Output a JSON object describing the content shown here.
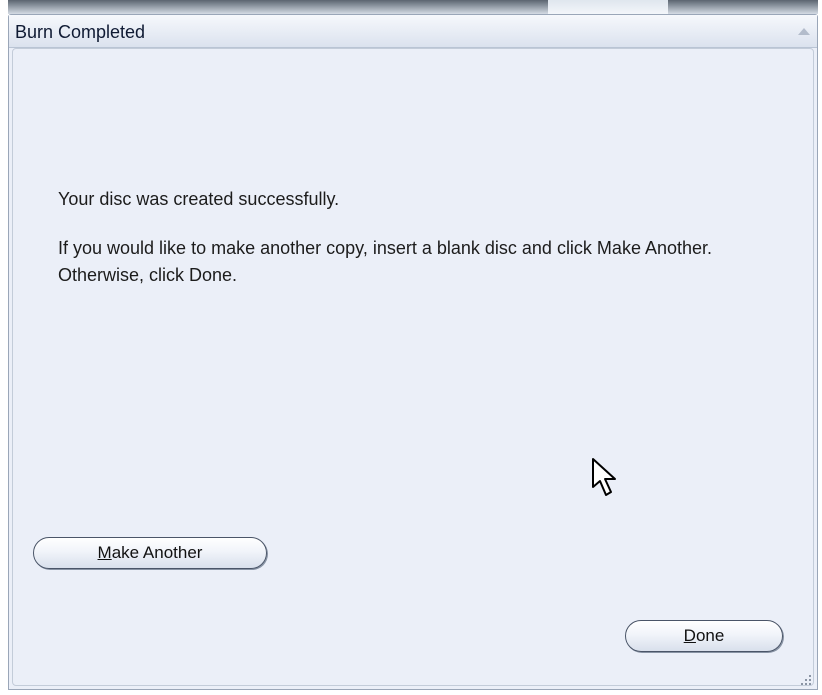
{
  "dialog": {
    "title": "Burn Completed",
    "message_success": "Your disc was created successfully.",
    "message_instructions": "If you would like to make another copy, insert a blank disc and click Make Another. Otherwise, click Done."
  },
  "buttons": {
    "make_another": {
      "accel": "M",
      "rest": "ake Another"
    },
    "done": {
      "accel": "D",
      "rest": "one"
    }
  },
  "icons": {
    "collapse": "chevron-up-icon",
    "cursor": "mouse-pointer-icon",
    "grip": "resize-grip-icon"
  },
  "colors": {
    "panel_background": "#ebeff8",
    "title_text": "#0f1a33",
    "body_text": "#1c1c1c",
    "button_border": "#4a5568"
  }
}
